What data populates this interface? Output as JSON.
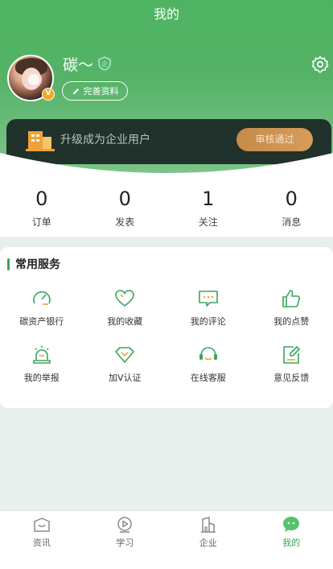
{
  "header": {
    "title": "我的",
    "username": "碳～",
    "edit_label": "完善资料",
    "avatar_badge": "V"
  },
  "upgrade": {
    "text": "升级成为企业用户",
    "button": "审核通过"
  },
  "stats": [
    {
      "value": "0",
      "label": "订单"
    },
    {
      "value": "0",
      "label": "发表"
    },
    {
      "value": "1",
      "label": "关注"
    },
    {
      "value": "0",
      "label": "消息"
    }
  ],
  "services": {
    "title": "常用服务",
    "items": [
      {
        "label": "碳资产银行",
        "icon": "gauge-icon"
      },
      {
        "label": "我的收藏",
        "icon": "heart-icon"
      },
      {
        "label": "我的评论",
        "icon": "comment-icon"
      },
      {
        "label": "我的点赞",
        "icon": "thumbs-up-icon"
      },
      {
        "label": "我的举报",
        "icon": "alarm-icon"
      },
      {
        "label": "加V认证",
        "icon": "diamond-icon"
      },
      {
        "label": "在线客服",
        "icon": "headset-icon"
      },
      {
        "label": "意见反馈",
        "icon": "feedback-icon"
      }
    ]
  },
  "tabs": [
    {
      "label": "资讯",
      "icon": "news-icon",
      "active": false
    },
    {
      "label": "学习",
      "icon": "play-icon",
      "active": false
    },
    {
      "label": "企业",
      "icon": "building-icon",
      "active": false
    },
    {
      "label": "我的",
      "icon": "chat-bubble-icon",
      "active": true
    }
  ],
  "colors": {
    "primary": "#3aa55a",
    "header_top": "#4eb463",
    "card_dark": "#21312b",
    "gold": "#c48b4b"
  }
}
